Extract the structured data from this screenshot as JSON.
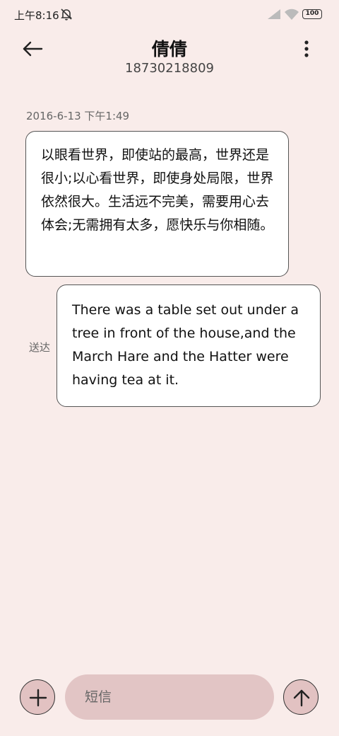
{
  "status_bar": {
    "time": "上午8:16",
    "battery": "100",
    "icons": [
      "mute-icon",
      "signal-icon",
      "wifi-icon",
      "battery-icon"
    ]
  },
  "header": {
    "contact_name": "倩倩",
    "contact_number": "18730218809",
    "icons": [
      "back-arrow-icon",
      "more-vertical-icon"
    ]
  },
  "conversation": {
    "timestamp": "2016-6-13 下午1:49",
    "received_message": "以眼看世界，即使站的最高，世界还是很小;以心看世界，即使身处局限，世界依然很大。生活远不完美，需要用心去体会;无需拥有太多，愿快乐与你相随。",
    "sent_message": "There was a table set out under a tree in front of the house,and the March Hare and the Hatter were having tea at it.",
    "sent_status": "送达"
  },
  "composer": {
    "placeholder": "短信",
    "icons": [
      "plus-icon",
      "arrow-up-icon"
    ]
  },
  "colors": {
    "background": "#f9ecea",
    "bubble": "#ffffff",
    "input_fill": "#e2c5c5",
    "button_fill": "#e2c2c2"
  }
}
